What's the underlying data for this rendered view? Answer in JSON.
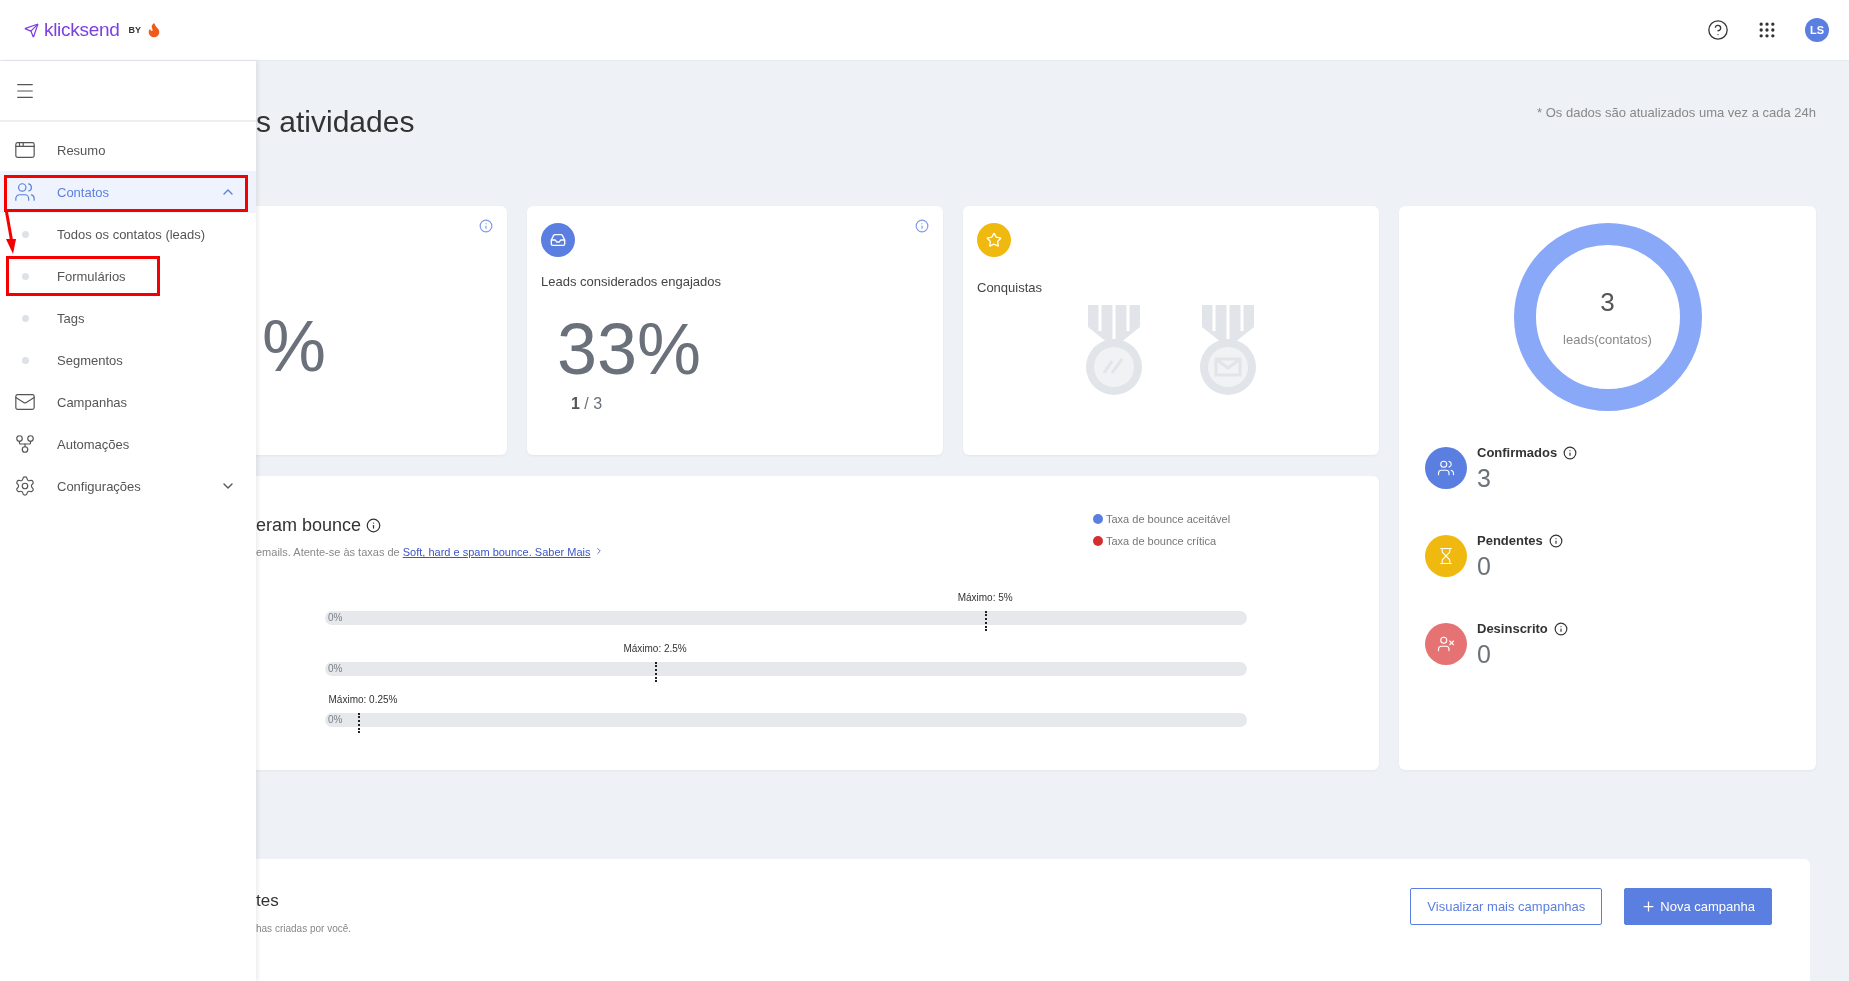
{
  "header": {
    "brand": "klicksend",
    "by": "BY",
    "avatar": "LS"
  },
  "sidebar": {
    "items": [
      {
        "label": "Resumo",
        "selected": false,
        "annotated": false
      },
      {
        "label": "Contatos",
        "selected": true,
        "annotated": true,
        "expanded": true,
        "children": [
          {
            "label": "Todos os contatos (leads)",
            "selected": false,
            "annotated": false
          },
          {
            "label": "Formulários",
            "selected": false,
            "annotated": true
          },
          {
            "label": "Tags",
            "selected": false,
            "annotated": false
          },
          {
            "label": "Segmentos",
            "selected": false,
            "annotated": false
          }
        ]
      },
      {
        "label": "Campanhas",
        "selected": false,
        "annotated": false
      },
      {
        "label": "Automações",
        "selected": false,
        "annotated": false
      },
      {
        "label": "Configurações",
        "selected": false,
        "annotated": false,
        "expanded": false
      }
    ]
  },
  "page": {
    "title": "s atividades",
    "note": "* Os dados são atualizados uma vez a cada 24h"
  },
  "cards": [
    {
      "kind": "metric",
      "info": true,
      "value": "%"
    },
    {
      "kind": "metric",
      "info": true,
      "color": "#5b7fe0",
      "label": "Leads considerados engajados",
      "value": "33%",
      "ratio": "**1** / 3"
    },
    {
      "kind": "achievements",
      "info": false,
      "color": "#f0b90f",
      "label": "Conquistas",
      "medals": [
        {
          "earned": false
        },
        {
          "earned": false
        }
      ]
    }
  ],
  "bounce": {
    "title": "eram bounce",
    "text": "emails. Atente-se às taxas de ",
    "link": "Soft, hard e spam bounce. Saber Mais",
    "legend": [
      {
        "label": "Taxa de bounce aceitável",
        "color": "#5b7fe0"
      },
      {
        "label": "Taxa de bounce crítica",
        "color": "#d32f2f"
      }
    ],
    "bars": [
      {
        "max": "Máximo: 5%",
        "reading": "0%",
        "level": 0
      },
      {
        "max": "Máximo: 2.5%",
        "reading": "0%",
        "level": 0
      },
      {
        "max": "Máximo: 0.25%",
        "reading": "0%",
        "level": 0
      }
    ]
  },
  "leads": {
    "total": "3",
    "caption": "leads(contatos)",
    "stats": [
      {
        "label": "Confirmados",
        "value": "3",
        "color": "#5b7fe0"
      },
      {
        "label": "Pendentes",
        "value": "0",
        "color": "#f0b90f"
      },
      {
        "label": "Desinscrito",
        "value": "0",
        "color": "#e57373"
      }
    ]
  },
  "campaigns": {
    "title": "tes",
    "subtitle": "has criadas por você.",
    "buttons": [
      {
        "label": "Visualizar mais campanhas",
        "kind": "outline"
      },
      {
        "label": "Nova campanha",
        "kind": "primary"
      }
    ]
  }
}
